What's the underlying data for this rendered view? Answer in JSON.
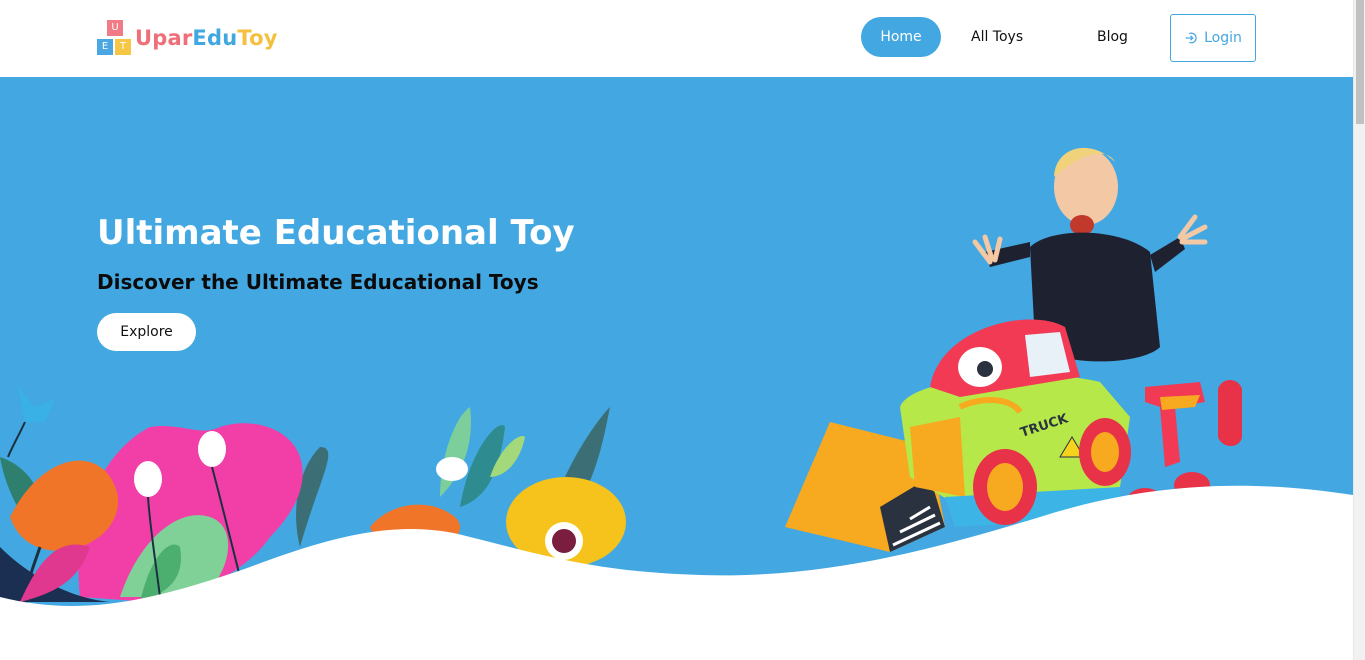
{
  "brand": {
    "part1": "Upar",
    "part2": "Edu",
    "part3": "Toy",
    "blocks": [
      "U",
      "E",
      "T"
    ],
    "colors": {
      "red": "#ef6f79",
      "blue": "#41a7e0",
      "yellow": "#f4c040"
    }
  },
  "nav": {
    "items": [
      {
        "label": "Home",
        "active": true
      },
      {
        "label": "All Toys",
        "active": false
      },
      {
        "label": "Blog",
        "active": false
      }
    ],
    "login_label": "Login",
    "login_icon": "login-icon"
  },
  "hero": {
    "title": "Ultimate Educational Toy",
    "subtitle": "Discover the Ultimate Educational Toys",
    "button_label": "Explore",
    "background": "#43a7e2",
    "illustrations": [
      "flowers-illustration",
      "child-with-toy-truck-image"
    ]
  },
  "toy_decal": "TRUCK"
}
